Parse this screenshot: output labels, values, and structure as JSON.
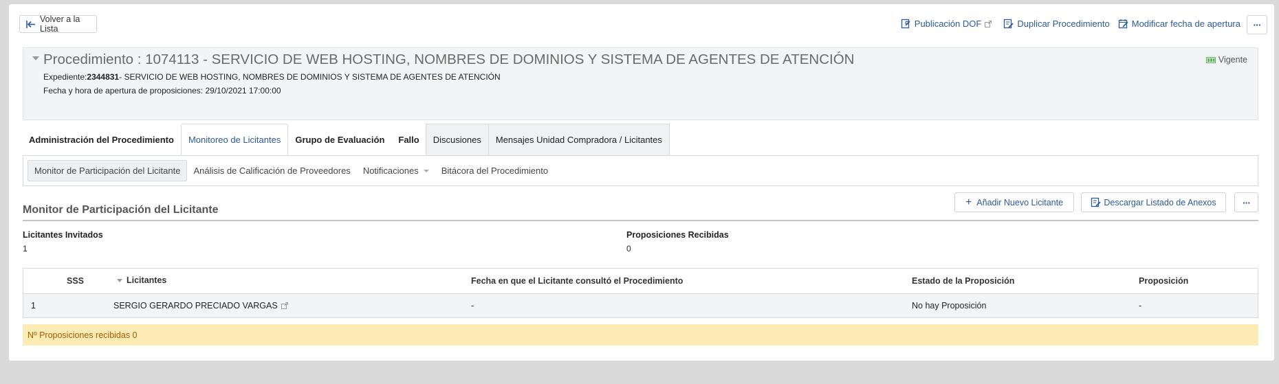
{
  "toolbar": {
    "back_label": "Volver a la Lista",
    "dof_label": "Publicación DOF",
    "duplicate_label": "Duplicar Procedimiento",
    "modify_date_label": "Modificar fecha de apertura",
    "more_label": "···"
  },
  "procedure": {
    "title": "Procedimiento : 1074113 - SERVICIO DE WEB HOSTING, NOMBRES DE DOMINIOS Y SISTEMA DE AGENTES DE ATENCIÓN",
    "status": "Vigente",
    "expediente_label": "Expediente:",
    "expediente_number": "2344831",
    "expediente_desc": "- SERVICIO DE WEB HOSTING, NOMBRES DE DOMINIOS Y SISTEMA DE AGENTES DE ATENCIÓN",
    "opening": "Fecha y hora de apertura de proposiciones: 29/10/2021 17:00:00"
  },
  "tabs": [
    {
      "label": "Administración del Procedimiento"
    },
    {
      "label": "Monitoreo de Licitantes"
    },
    {
      "label": "Grupo de Evaluación"
    },
    {
      "label": "Fallo"
    },
    {
      "label": "Discusiones"
    },
    {
      "label": "Mensajes Unidad Compradora / Licitantes"
    }
  ],
  "subnav": [
    {
      "label": "Monitor de Participación del Licitante"
    },
    {
      "label": "Análisis de Calificación de Proveedores"
    },
    {
      "label": "Notificaciones"
    },
    {
      "label": "Bitácora del Procedimiento"
    }
  ],
  "section": {
    "title": "Monitor de Participación del Licitante",
    "add_label": "Añadir Nuevo Licitante",
    "download_label": "Descargar Listado de Anexos",
    "more_label": "···"
  },
  "stats": {
    "invited_label": "Licitantes Invitados",
    "invited_value": "1",
    "received_label": "Proposiciones Recibidas",
    "received_value": "0"
  },
  "table": {
    "headers": [
      "SSS",
      "Licitantes",
      "Fecha en que el Licitante consultó el Procedimiento",
      "Estado de la Proposición",
      "Proposición"
    ],
    "rows": [
      [
        "1",
        "SERGIO GERARDO PRECIADO VARGAS",
        "-",
        "No hay Proposición",
        "-"
      ]
    ]
  },
  "alert": "Nº Proposiciones recibidas 0"
}
